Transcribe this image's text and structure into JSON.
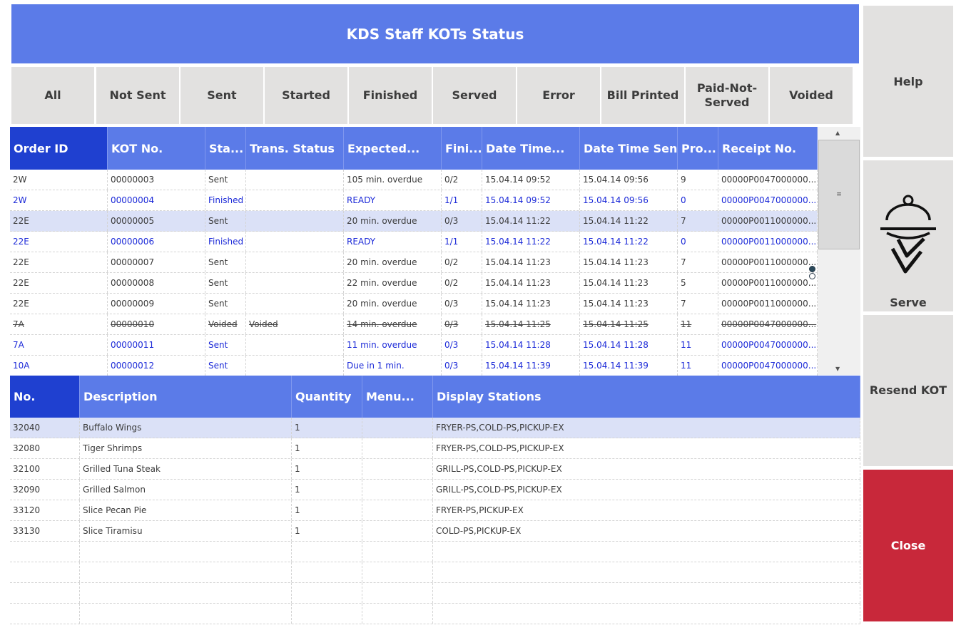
{
  "title": "KDS Staff KOTs Status",
  "filters": [
    "All",
    "Not Sent",
    "Sent",
    "Started",
    "Finished",
    "Served",
    "Error",
    "Bill Printed",
    "Paid-Not-Served",
    "Voided"
  ],
  "kot_columns": [
    "Order ID",
    "KOT No.",
    "Sta...",
    "Trans. Status",
    "Expected...",
    "Fini...",
    "Date Time...",
    "Date Time Sent",
    "Pro...",
    "Receipt No."
  ],
  "kot_rows": [
    {
      "style": "dark",
      "cells": [
        "2W",
        "00000003",
        "Sent",
        "",
        "105 min. overdue",
        "0/2",
        "15.04.14 09:52",
        "15.04.14 09:56",
        "9",
        "00000P0047000000..."
      ]
    },
    {
      "style": "blue",
      "cells": [
        "2W",
        "00000004",
        "Finished",
        "",
        "READY",
        "1/1",
        "15.04.14 09:52",
        "15.04.14 09:56",
        "0",
        "00000P0047000000..."
      ]
    },
    {
      "style": "dark selected",
      "cells": [
        "22E",
        "00000005",
        "Sent",
        "",
        "20 min. overdue",
        "0/3",
        "15.04.14 11:22",
        "15.04.14 11:22",
        "7",
        "00000P0011000000..."
      ]
    },
    {
      "style": "blue",
      "cells": [
        "22E",
        "00000006",
        "Finished",
        "",
        "READY",
        "1/1",
        "15.04.14 11:22",
        "15.04.14 11:22",
        "0",
        "00000P0011000000..."
      ]
    },
    {
      "style": "dark",
      "cells": [
        "22E",
        "00000007",
        "Sent",
        "",
        "20 min. overdue",
        "0/2",
        "15.04.14 11:23",
        "15.04.14 11:23",
        "7",
        "00000P0011000000..."
      ]
    },
    {
      "style": "dark",
      "cells": [
        "22E",
        "00000008",
        "Sent",
        "",
        "22 min. overdue",
        "0/2",
        "15.04.14 11:23",
        "15.04.14 11:23",
        "5",
        "00000P0011000000..."
      ]
    },
    {
      "style": "dark",
      "cells": [
        "22E",
        "00000009",
        "Sent",
        "",
        "20 min. overdue",
        "0/3",
        "15.04.14 11:23",
        "15.04.14 11:23",
        "7",
        "00000P0011000000..."
      ]
    },
    {
      "style": "voided",
      "cells": [
        "7A",
        "00000010",
        "Voided",
        "Voided",
        "14 min. overdue",
        "0/3",
        "15.04.14 11:25",
        "15.04.14 11:25",
        "11",
        "00000P0047000000..."
      ]
    },
    {
      "style": "blue",
      "cells": [
        "7A",
        "00000011",
        "Sent",
        "",
        "11 min. overdue",
        "0/3",
        "15.04.14 11:28",
        "15.04.14 11:28",
        "11",
        "00000P0047000000..."
      ]
    },
    {
      "style": "blue",
      "cells": [
        "10A",
        "00000012",
        "Sent",
        "",
        "Due in 1 min.",
        "0/3",
        "15.04.14 11:39",
        "15.04.14 11:39",
        "11",
        "00000P0047000000..."
      ]
    }
  ],
  "item_columns": [
    "No.",
    "Description",
    "Quantity",
    "Menu...",
    "Display Stations"
  ],
  "item_rows": [
    [
      "32040",
      "Buffalo Wings",
      "1",
      "",
      "FRYER-PS,COLD-PS,PICKUP-EX"
    ],
    [
      "32080",
      "Tiger Shrimps",
      "1",
      "",
      "FRYER-PS,COLD-PS,PICKUP-EX"
    ],
    [
      "32100",
      "Grilled Tuna Steak",
      "1",
      "",
      "GRILL-PS,COLD-PS,PICKUP-EX"
    ],
    [
      "32090",
      "Grilled Salmon",
      "1",
      "",
      "GRILL-PS,COLD-PS,PICKUP-EX"
    ],
    [
      "33120",
      "Slice Pecan Pie",
      "1",
      "",
      "FRYER-PS,PICKUP-EX"
    ],
    [
      "33130",
      "Slice Tiramisu",
      "1",
      "",
      "COLD-PS,PICKUP-EX"
    ],
    [
      "",
      "",
      "",
      "",
      ""
    ],
    [
      "",
      "",
      "",
      "",
      ""
    ],
    [
      "",
      "",
      "",
      "",
      ""
    ],
    [
      "",
      "",
      "",
      "",
      ""
    ]
  ],
  "side": {
    "help": "Help",
    "serve": "Serve",
    "resend": "Resend KOT",
    "close": "Close"
  },
  "icons": {
    "scroll_up": "▲",
    "scroll_down": "▼",
    "grip": "≡"
  },
  "colors": {
    "header_blue": "#5b7be8",
    "selected_header": "#1f40d0",
    "close_red": "#c8283a",
    "link_blue": "#1c2ad8"
  }
}
